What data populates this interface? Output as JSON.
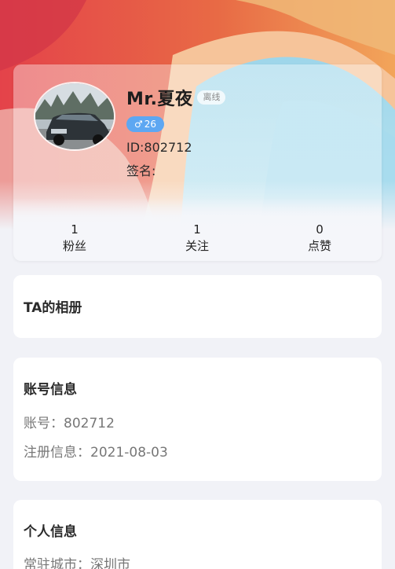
{
  "profile": {
    "name": "Mr.夏夜",
    "status": "离线",
    "gender_icon": "male-icon",
    "age": "26",
    "id_text": "ID:802712",
    "signature_label": "签名:"
  },
  "stats": [
    {
      "value": "1",
      "label": "粉丝"
    },
    {
      "value": "1",
      "label": "关注"
    },
    {
      "value": "0",
      "label": "点赞"
    }
  ],
  "album": {
    "title": "TA的相册"
  },
  "account": {
    "title": "账号信息",
    "lines": [
      "账号：802712",
      "注册信息：2021-08-03"
    ]
  },
  "personal": {
    "title": "个人信息",
    "lines": [
      "常驻城市：深圳市"
    ]
  },
  "colors": {
    "page_bg": "#f1f2f7",
    "gender_badge": "#5da7f2",
    "card_bg": "#ffffff"
  }
}
